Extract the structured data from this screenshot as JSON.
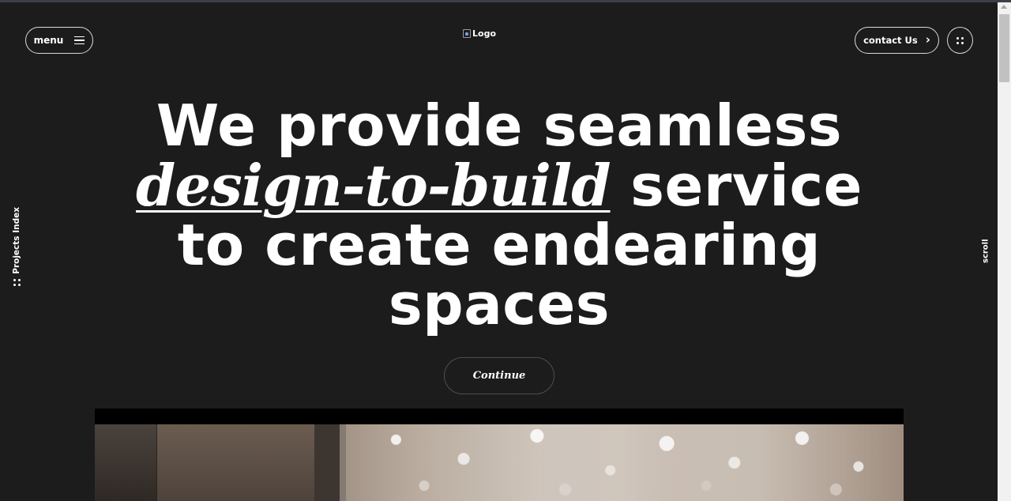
{
  "header": {
    "menu_label": "menu",
    "logo_alt": "Logo",
    "contact_label": "contact Us"
  },
  "side": {
    "projects_index_label": "Projects Index",
    "scroll_label": "scroll"
  },
  "hero": {
    "line1": "We provide seamless",
    "line2_italic": "design-to-build",
    "line2_rest": " service",
    "line3": "to create endearing",
    "line4": "spaces",
    "continue_label": "Continue"
  },
  "icons": {
    "menu": "hamburger-icon",
    "contact": "chevron-right-icon",
    "apps": "dot-grid-icon",
    "projects": "dot-grid-icon",
    "logo": "broken-image-icon"
  },
  "colors": {
    "background": "#1d1c1c",
    "text": "#ffffff",
    "button_border": "#d9d9d9"
  }
}
